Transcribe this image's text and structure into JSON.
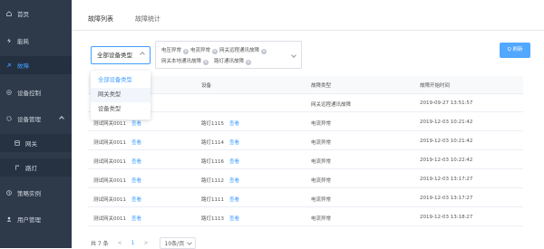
{
  "sidebar": {
    "items": [
      {
        "label": "首页",
        "icon": "home-icon"
      },
      {
        "label": "能耗",
        "icon": "energy-icon"
      },
      {
        "label": "故障",
        "icon": "fault-icon",
        "active": true
      },
      {
        "label": "设备控制",
        "icon": "control-icon"
      },
      {
        "label": "设备管理",
        "icon": "device-icon",
        "expanded": true
      },
      {
        "label": "网关",
        "icon": "gateway-icon",
        "sub": true
      },
      {
        "label": "路灯",
        "icon": "streetlight-icon",
        "sub": true
      },
      {
        "label": "策略实例",
        "icon": "strategy-icon"
      },
      {
        "label": "用户管理",
        "icon": "user-icon"
      }
    ]
  },
  "tabs": [
    {
      "label": "故障列表",
      "active": true
    },
    {
      "label": "故障统计",
      "active": false
    }
  ],
  "filters": {
    "device_type_value": "全部设备类型",
    "fault_chips": [
      "电压异常",
      "电流异常",
      "网关远程通讯故障",
      "网关本地通讯故障",
      "路灯通讯故障"
    ],
    "search_label": "Q 刷新"
  },
  "dropdown": {
    "options": [
      "全部设备类型",
      "网关类型",
      "设备类型"
    ]
  },
  "table": {
    "columns": [
      "网关",
      "设备",
      "故障类型",
      "故障开始时间"
    ],
    "link_text": "查看",
    "rows": [
      {
        "gateway": "",
        "device": "",
        "fault": "网关远程通讯故障",
        "time": "2019-09-27 13:51:57"
      },
      {
        "gateway": "测试网关0011",
        "device": "路灯1115",
        "fault": "电流异常",
        "time": "2019-12-03 10:21:42"
      },
      {
        "gateway": "测试网关0011",
        "device": "路灯1114",
        "fault": "电流异常",
        "time": "2019-12-03 10:21:42"
      },
      {
        "gateway": "测试网关0011",
        "device": "路灯1116",
        "fault": "电流异常",
        "time": "2019-12-03 10:22:42"
      },
      {
        "gateway": "测试网关0011",
        "device": "路灯1112",
        "fault": "电流异常",
        "time": "2019-12-03 13:17:27"
      },
      {
        "gateway": "测试网关0011",
        "device": "路灯1111",
        "fault": "电流异常",
        "time": "2019-12-03 13:17:27"
      },
      {
        "gateway": "测试网关0011",
        "device": "路灯1113",
        "fault": "电流异常",
        "time": "2019-12-03 13:18:27"
      }
    ]
  },
  "pagination": {
    "total": "共 7 条",
    "prev": "<",
    "current_page": "1",
    "next": ">",
    "page_size": "10条/页"
  },
  "colors": {
    "sidebar_bg": "#2e3a4a",
    "accent": "#409eff",
    "button": "#52a7ff"
  }
}
